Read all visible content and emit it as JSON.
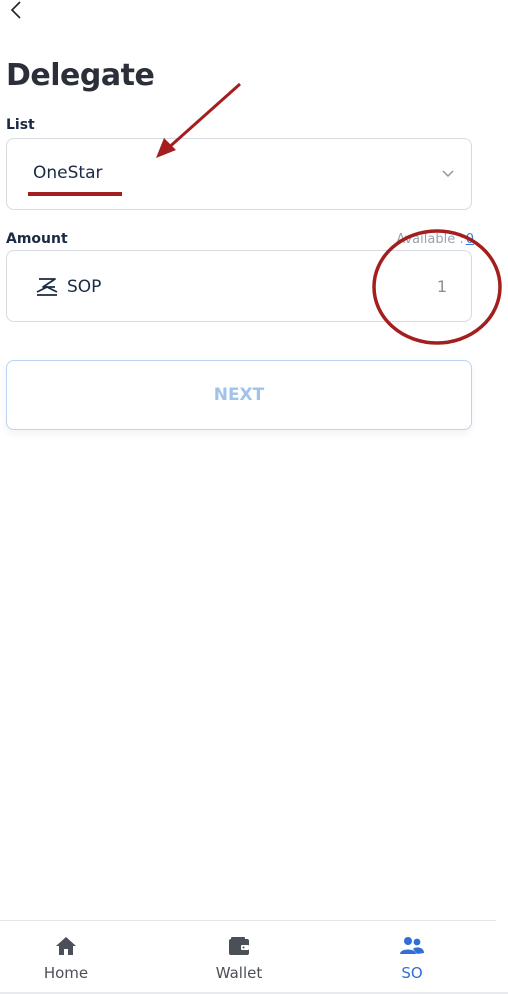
{
  "header": {
    "title": "Delegate"
  },
  "form": {
    "list_label": "List",
    "list_value": "OneStar",
    "amount_label": "Amount",
    "available_label": "Available :",
    "available_value": "0",
    "coin_name": "SOP",
    "amount_value": "1"
  },
  "actions": {
    "next_label": "NEXT"
  },
  "tabs": [
    {
      "label": "Home",
      "icon": "home-icon"
    },
    {
      "label": "Wallet",
      "icon": "wallet-icon"
    },
    {
      "label": "SO",
      "icon": "users-icon"
    }
  ],
  "colors": {
    "accent": "#2f6fd6",
    "annotation": "#a31f1f",
    "next_text": "#9fc3ea",
    "next_border": "#b9d3f0"
  }
}
